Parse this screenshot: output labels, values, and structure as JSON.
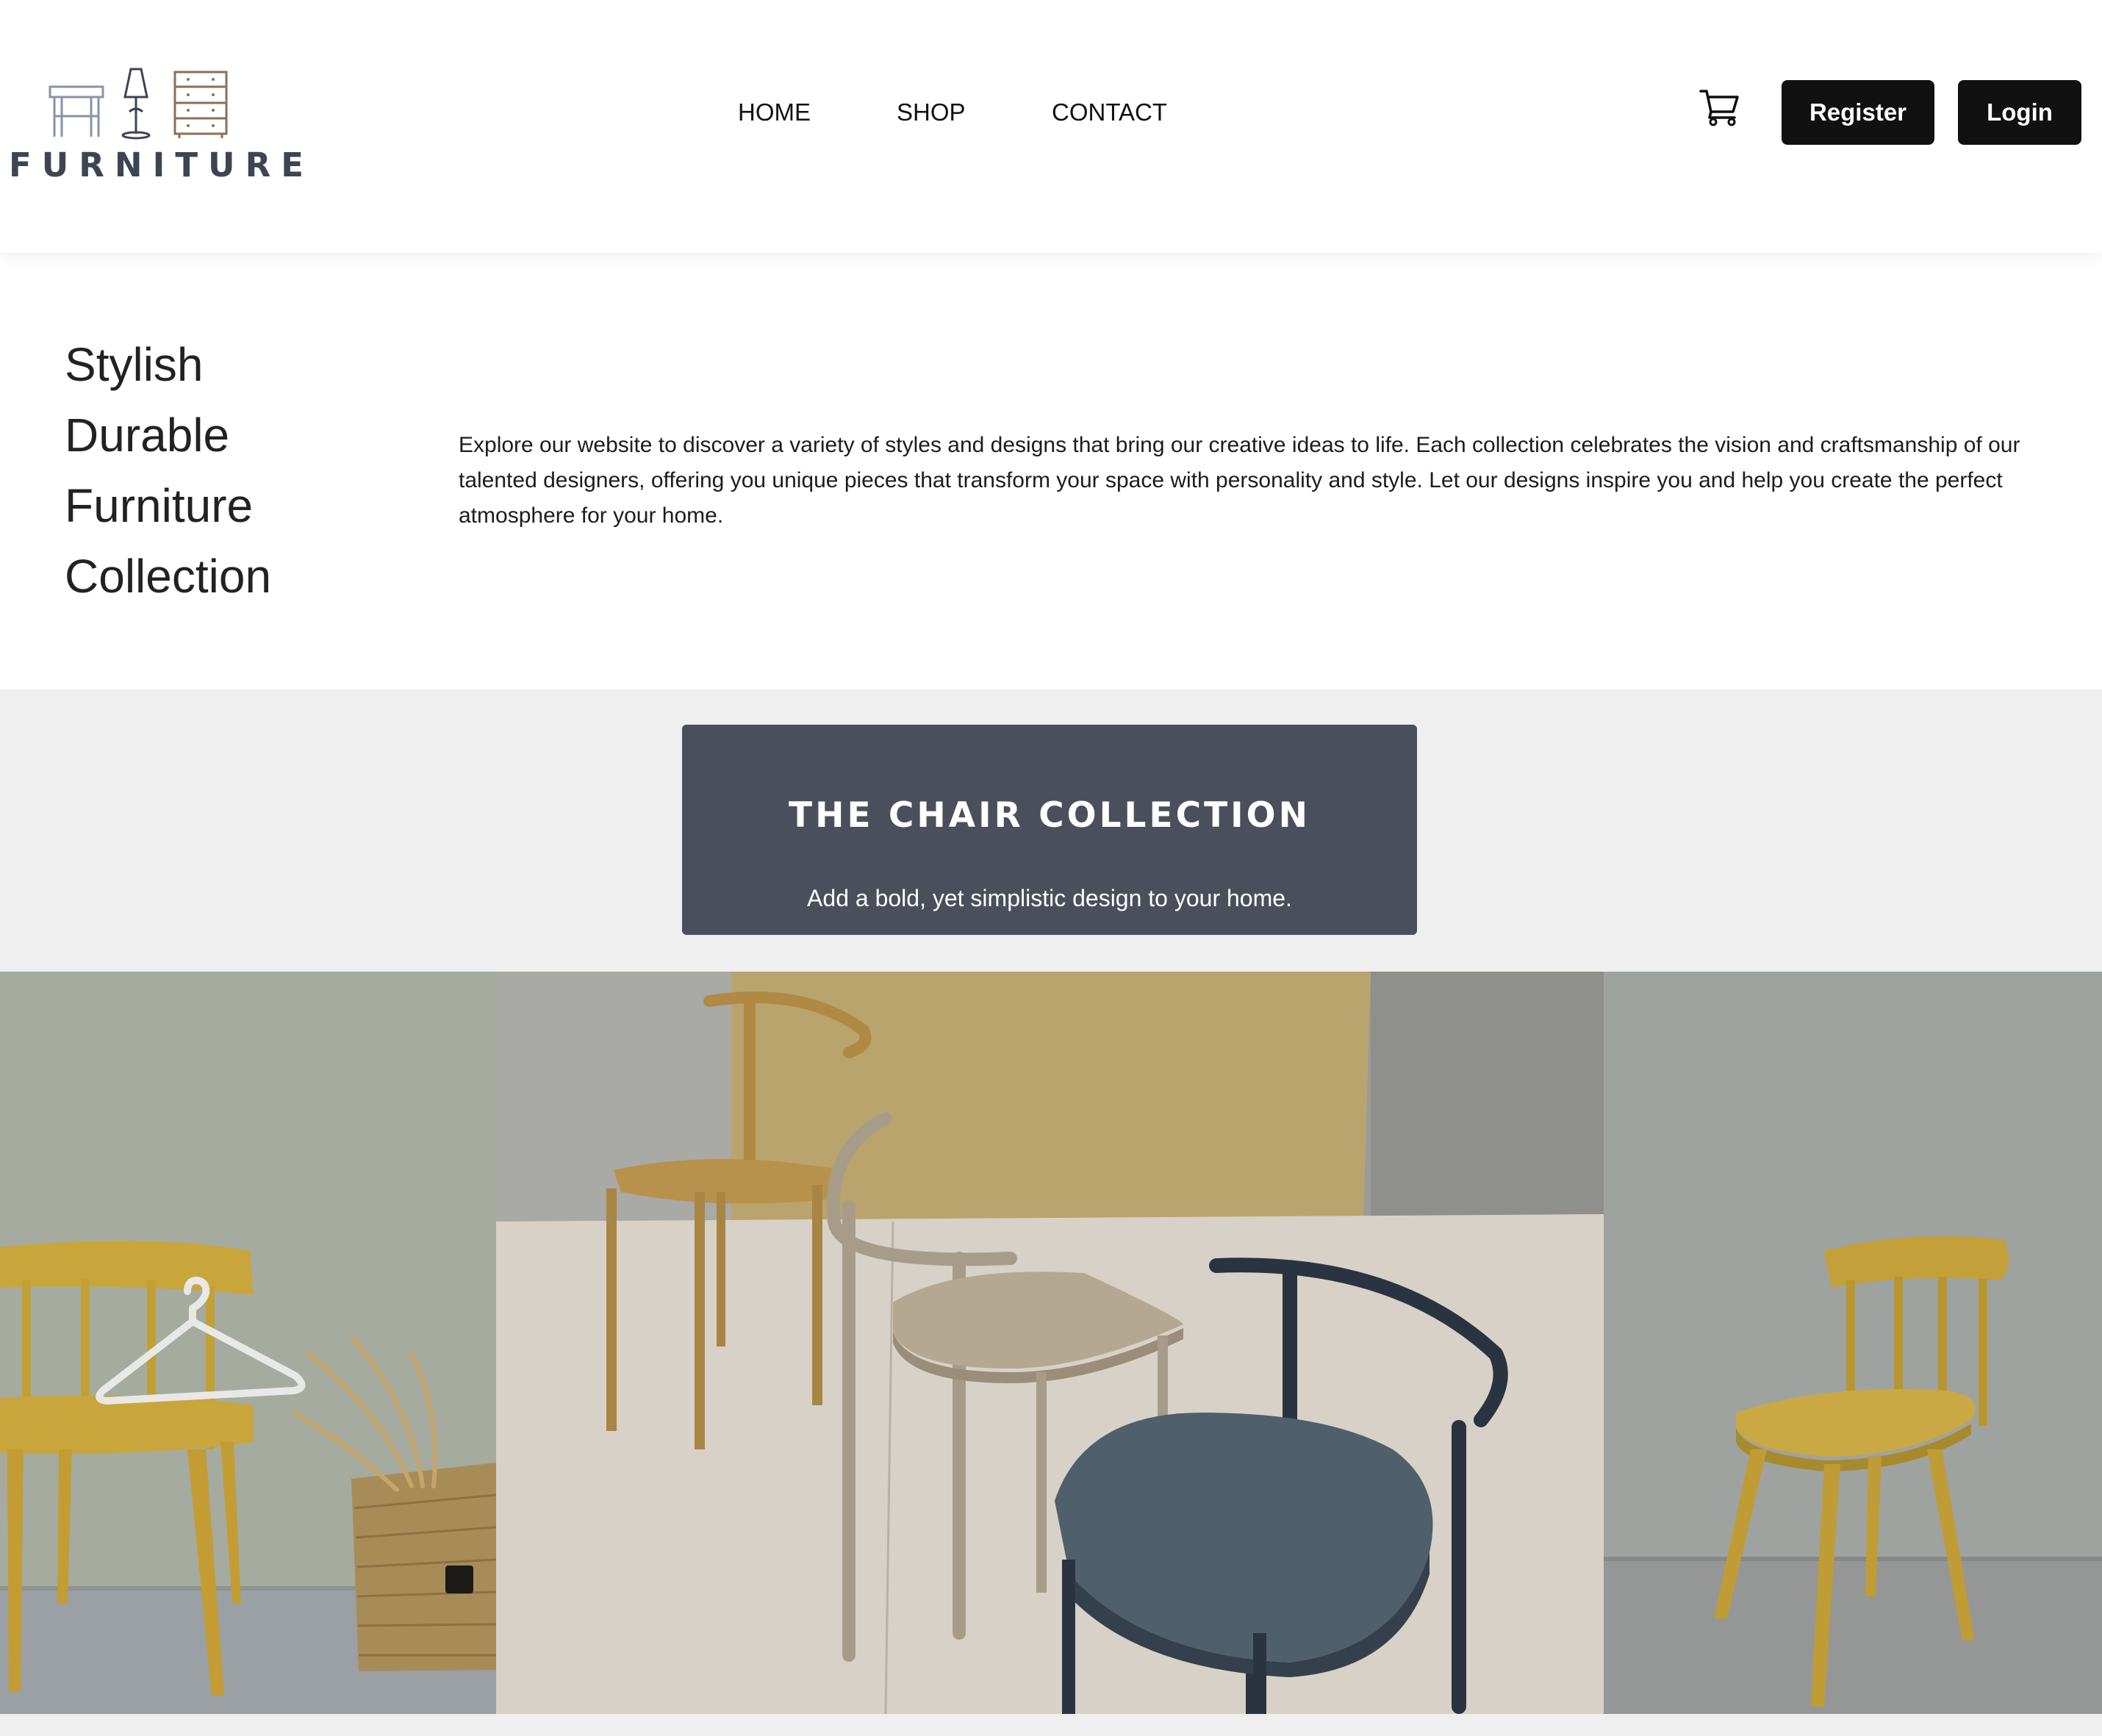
{
  "brand": {
    "name": "FURNITURE"
  },
  "nav": {
    "home": "HOME",
    "shop": "SHOP",
    "contact": "CONTACT"
  },
  "header": {
    "cart_icon": "cart-icon",
    "register_label": "Register",
    "login_label": "Login"
  },
  "intro": {
    "headline": [
      "Stylish",
      "Durable",
      "Furniture",
      "Collection"
    ],
    "text": "Explore our website to discover a variety of styles and designs that bring our creative ideas to life. Each collection celebrates the vision and craftsmanship of our talented designers, offering you unique pieces that transform your space with personality and style. Let our designs inspire you and help you create the perfect atmosphere for your home."
  },
  "collection": {
    "title": "THE CHAIR COLLECTION",
    "subtitle": "Add a bold, yet simplistic design to your home."
  },
  "colors": {
    "header_bg": "#ffffff",
    "banner_bg": "#4b4f5c",
    "button_bg": "#111111",
    "logo": "#3d4452",
    "chair_yellow": "#c9a63c"
  }
}
